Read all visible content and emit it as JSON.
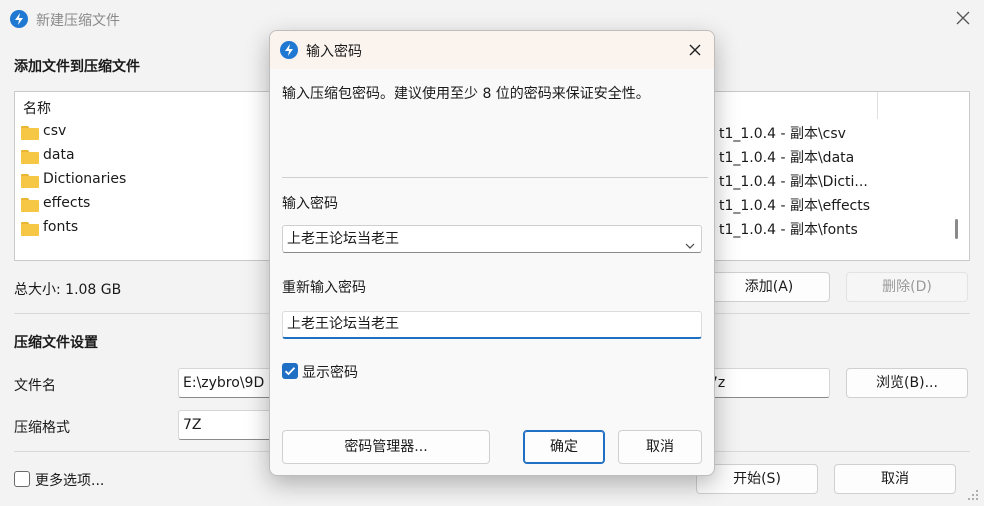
{
  "main": {
    "title": "新建压缩文件",
    "section_add": "添加文件到压缩文件",
    "list_header": "名称",
    "files": [
      {
        "name": "csv",
        "path": "t1_1.0.4 - 副本\\csv"
      },
      {
        "name": "data",
        "path": "t1_1.0.4 - 副本\\data"
      },
      {
        "name": "Dictionaries",
        "path": "t1_1.0.4 - 副本\\Dicti..."
      },
      {
        "name": "effects",
        "path": "t1_1.0.4 - 副本\\effects"
      },
      {
        "name": "fonts",
        "path": "t1_1.0.4 - 副本\\fonts"
      }
    ],
    "total_size": "总大小: 1.08 GB",
    "add_button": "添加(A)",
    "delete_button": "删除(D)",
    "section_settings": "压缩文件设置",
    "filename_label": "文件名",
    "filename_value_left": "E:\\zybro\\9D",
    "filename_value_right": "7z",
    "browse_button": "浏览(B)...",
    "format_label": "压缩格式",
    "format_value": "7Z",
    "more_options": "更多选项...",
    "start_button": "开始(S)",
    "cancel_button": "取消"
  },
  "dialog": {
    "title": "输入密码",
    "description": "输入压缩包密码。建议使用至少 8 位的密码来保证安全性。",
    "password_label": "输入密码",
    "password_value": "上老王论坛当老王",
    "reenter_label": "重新输入密码",
    "reenter_value": "上老王论坛当老王",
    "show_password_label": "显示密码",
    "show_password_checked": true,
    "manager_button": "密码管理器...",
    "ok_button": "确定",
    "cancel_button": "取消"
  },
  "colors": {
    "accent": "#1f6fc4",
    "folder": "#f6c744"
  }
}
